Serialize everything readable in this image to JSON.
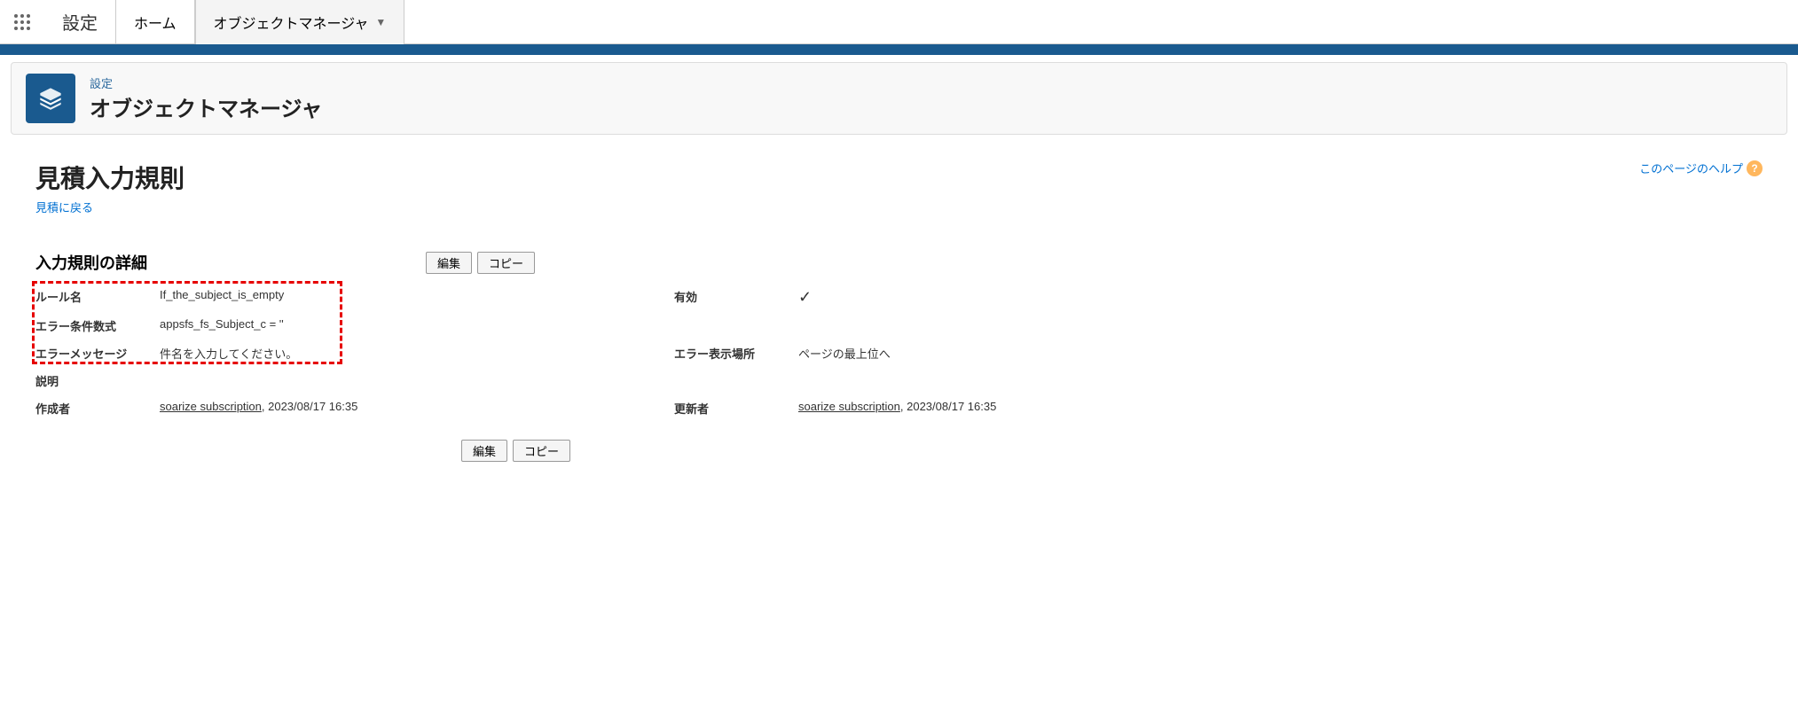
{
  "nav": {
    "app_label": "設定",
    "tabs": [
      {
        "label": "ホーム"
      },
      {
        "label": "オブジェクトマネージャ"
      }
    ]
  },
  "header": {
    "small": "設定",
    "big": "オブジェクトマネージャ"
  },
  "page": {
    "title": "見積入力規則",
    "back_link": "見積に戻る",
    "help_link": "このページのヘルプ"
  },
  "section": {
    "title": "入力規則の詳細",
    "buttons": {
      "edit": "編集",
      "copy": "コピー"
    }
  },
  "fields": {
    "rule_name_label": "ルール名",
    "rule_name_value": "If_the_subject_is_empty",
    "active_label": "有効",
    "active_value": "✓",
    "formula_label": "エラー条件数式",
    "formula_value": "appsfs_fs_Subject_c = ''",
    "message_label": "エラーメッセージ",
    "message_value": "件名を入力してください。",
    "location_label": "エラー表示場所",
    "location_value": "ページの最上位へ",
    "description_label": "説明",
    "description_value": "",
    "created_label": "作成者",
    "created_name": "soarize subscription",
    "created_date": ", 2023/08/17 16:35",
    "modified_label": "更新者",
    "modified_name": "soarize subscription",
    "modified_date": ", 2023/08/17 16:35"
  }
}
